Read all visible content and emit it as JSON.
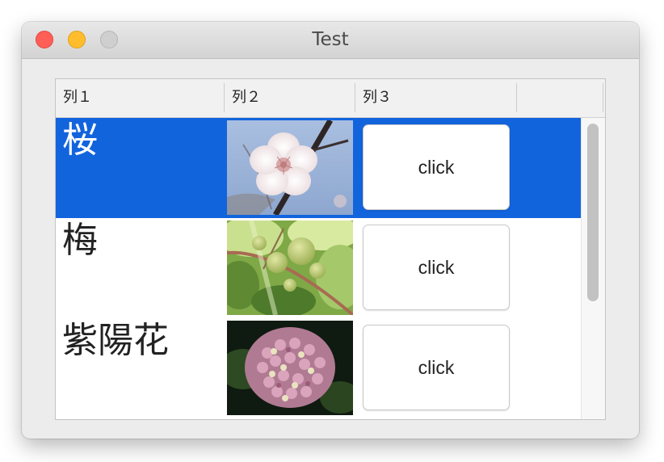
{
  "window": {
    "title": "Test"
  },
  "table": {
    "columns": [
      "列１",
      "列２",
      "列３",
      ""
    ],
    "rows": [
      {
        "name": "桜",
        "photo_icon": "cherry-blossom-photo",
        "button_label": "click",
        "selected": true
      },
      {
        "name": "梅",
        "photo_icon": "plum-fruit-photo",
        "button_label": "click",
        "selected": false
      },
      {
        "name": "紫陽花",
        "photo_icon": "hydrangea-photo",
        "button_label": "click",
        "selected": false
      }
    ]
  },
  "colors": {
    "selection": "#1264dd",
    "close": "#ff5f57",
    "minimize": "#ffbd2e",
    "zoom": "#cfcfcf"
  }
}
